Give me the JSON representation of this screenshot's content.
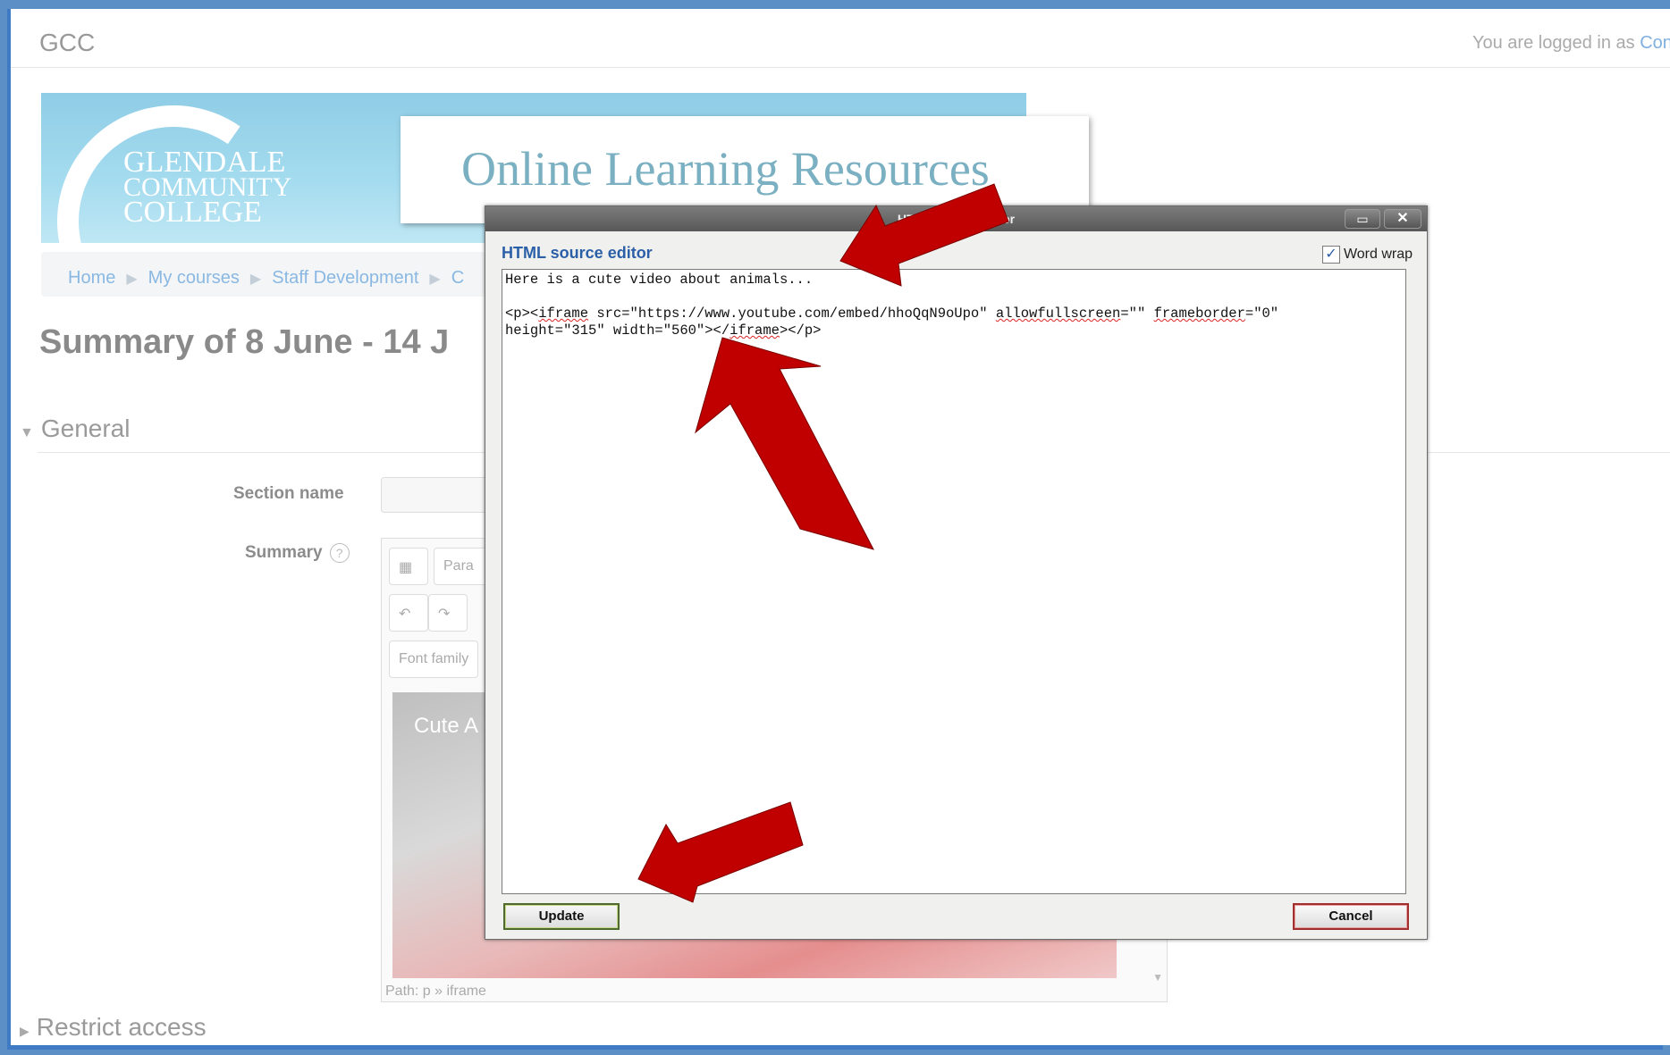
{
  "header": {
    "site_name": "GCC",
    "login_prefix": "You are logged in as ",
    "login_user": "Conn"
  },
  "banner": {
    "logo_line1": "GLENDALE",
    "logo_line2": "COMMUNITY",
    "logo_line3": "COLLEGE",
    "title": "Online Learning Resources"
  },
  "breadcrumb": {
    "items": [
      "Home",
      "My courses",
      "Staff Development",
      "C"
    ]
  },
  "page": {
    "title": "Summary of 8 June - 14 J",
    "general_heading": "General",
    "restrict_heading": "Restrict access"
  },
  "form": {
    "section_name_label": "Section name",
    "summary_label": "Summary",
    "help_glyph": "?",
    "paragraph_label": "Para",
    "font_family_label": "Font family",
    "video_title": "Cute A",
    "path_text": "Path: p » iframe"
  },
  "dialog": {
    "title": "HTML source editor",
    "heading": "HTML source editor",
    "word_wrap_label": "Word wrap",
    "word_wrap_checked": true,
    "source_line1": "Here is a cute video about animals...",
    "source_code_parts": {
      "p_open": "<p><",
      "iframe1": "iframe",
      "src": " src=\"https://www.youtube.com/embed/hhoQqN9oUpo\" ",
      "allowfullscreen": "allowfullscreen",
      "af_value": "=\"\" ",
      "frameborder": "frameborder",
      "fb_value": "=\"0\"",
      "line2_start": "height=\"315\" width=\"560\"></",
      "iframe2": "iframe",
      "line2_end": "></p>"
    },
    "update_label": "Update",
    "cancel_label": "Cancel"
  },
  "colors": {
    "annotation_arrow": "#c00000",
    "frame_border": "#3f7bc4",
    "link": "#8ab8e2",
    "dialog_heading": "#2b5fa8"
  },
  "icons": {
    "maximize": "maximize-icon",
    "close": "close-icon",
    "undo": "undo-icon",
    "redo": "redo-icon",
    "toolbar_toggle": "toolbar-toggle-icon"
  }
}
